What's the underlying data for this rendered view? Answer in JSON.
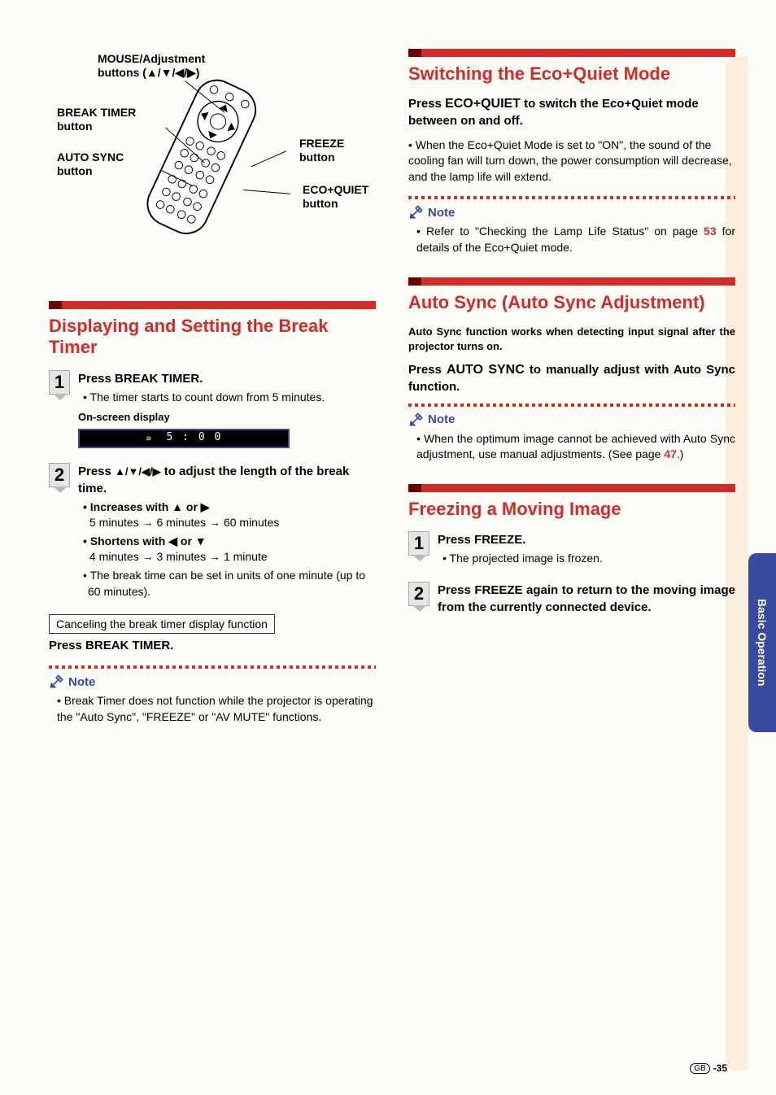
{
  "sideTab": "Basic Operation",
  "pageNum": "-35",
  "pageRegion": "GB",
  "remote": {
    "labels": {
      "mouse": "MOUSE/Adjustment",
      "mouseSub": "buttons (▲/▼/◀/▶)",
      "breakTimer1": "BREAK TIMER",
      "breakTimer2": "button",
      "autoSync1": "AUTO SYNC",
      "autoSync2": "button",
      "freeze1": "FREEZE",
      "freeze2": "button",
      "eco1": "ECO+QUIET",
      "eco2": "button"
    }
  },
  "left": {
    "h1": "Displaying and Setting the Break Timer",
    "step1": {
      "num": "1",
      "press": "Press ",
      "btn": "BREAK TIMER",
      "dot": ".",
      "bullet": "• The timer starts to count down from 5 minutes.",
      "osdLabel": "On-screen display",
      "osdTime": "5 : 0 0"
    },
    "step2": {
      "num": "2",
      "press": "Press ",
      "arrows": "▲/▼/◀/▶",
      "rest": " to adjust the length of the break time.",
      "incLabel": "• Increases with ▲ or ▶",
      "incText": "5 minutes → 6 minutes → 60 minutes",
      "decLabel": "• Shortens with ◀ or ▼",
      "decText": "4 minutes → 3 minutes → 1 minute",
      "unitText": "• The break time can be set in units of one minute (up to 60 minutes)."
    },
    "cancelBox": "Canceling the break timer display function",
    "cancelPress": "Press ",
    "cancelBtn": "BREAK TIMER",
    "cancelDot": ".",
    "noteTitle": "Note",
    "noteText": "• Break Timer does not function while the projector is operating the \"Auto Sync\", \"FREEZE\" or \"AV MUTE\" functions."
  },
  "right": {
    "eco": {
      "h": "Switching the Eco+Quiet Mode",
      "introPre": "Press ",
      "introBtn": "ECO+QUIET",
      "introPost": " to switch the Eco+Quiet mode between on and off.",
      "bullet": "• When the Eco+Quiet Mode is set to \"ON\", the sound of the cooling fan will turn down, the power consumption will decrease, and the lamp life will extend.",
      "noteTitle": "Note",
      "notePre": "• Refer to \"Checking the Lamp Life Status\" on page ",
      "notePage": "53",
      "notePost": " for details of the Eco+Quiet mode."
    },
    "autosync": {
      "h": "Auto Sync (Auto Sync Adjustment)",
      "intro": "Auto Sync function works when detecting input signal after the projector turns on.",
      "pressPre": "Press ",
      "pressBtn": "AUTO SYNC",
      "pressPost": " to manually adjust with Auto Sync function.",
      "noteTitle": "Note",
      "notePre": "• When the optimum image cannot be achieved with Auto Sync adjustment, use manual adjustments. (See page ",
      "notePage": "47",
      "notePost": ".)"
    },
    "freeze": {
      "h": "Freezing a Moving Image",
      "step1": {
        "num": "1",
        "press": "Press ",
        "btn": "FREEZE",
        "dot": ".",
        "bullet": "• The projected image is frozen."
      },
      "step2": {
        "num": "2",
        "press": "Press ",
        "btn": "FREEZE",
        "rest": " again to return to the moving image from the currently connected device."
      }
    }
  }
}
